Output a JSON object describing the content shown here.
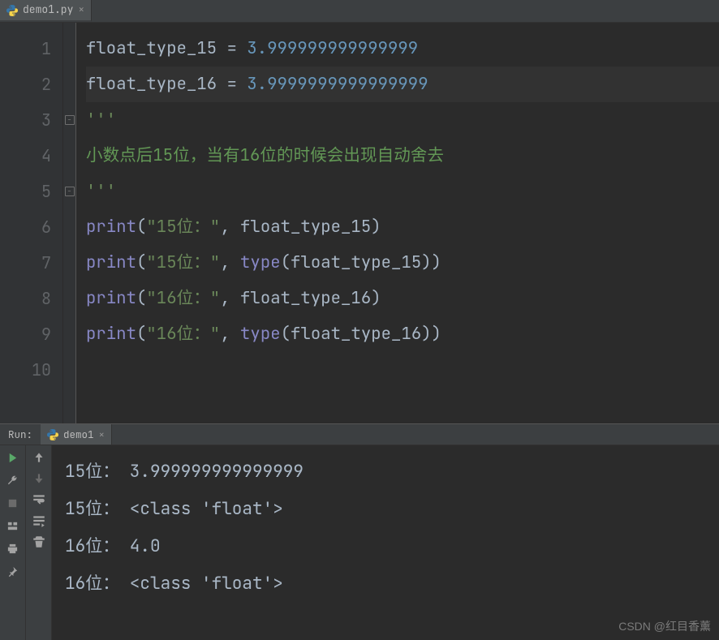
{
  "tab": {
    "filename": "demo1.py"
  },
  "gutter": [
    "1",
    "2",
    "3",
    "4",
    "5",
    "6",
    "7",
    "8",
    "9",
    "10"
  ],
  "code": {
    "l1": {
      "var": "float_type_15",
      "op": " = ",
      "num": "3.999999999999999"
    },
    "l2": {
      "var": "float_type_16",
      "op": " = ",
      "num": "3.9999999999999999"
    },
    "l3": {
      "doc": "'''"
    },
    "l4": {
      "comment": "小数点后15位，当有16位的时候会出现自动舍去"
    },
    "l5": {
      "doc": "'''"
    },
    "l6": {
      "fn": "print",
      "s": "\"15位：\"",
      "arg": "float_type_15"
    },
    "l7": {
      "fn": "print",
      "s": "\"15位：\"",
      "b": "type",
      "arg": "float_type_15"
    },
    "l8": {
      "fn": "print",
      "s": "\"16位：\"",
      "arg": "float_type_16"
    },
    "l9": {
      "fn": "print",
      "s": "\"16位：\"",
      "b": "type",
      "arg": "float_type_16"
    }
  },
  "run": {
    "label": "Run:",
    "tab": "demo1",
    "out": [
      "15位： 3.999999999999999",
      "15位： <class 'float'>",
      "16位： 4.0",
      "16位： <class 'float'>"
    ]
  },
  "watermark": "CSDN @红目香薰"
}
